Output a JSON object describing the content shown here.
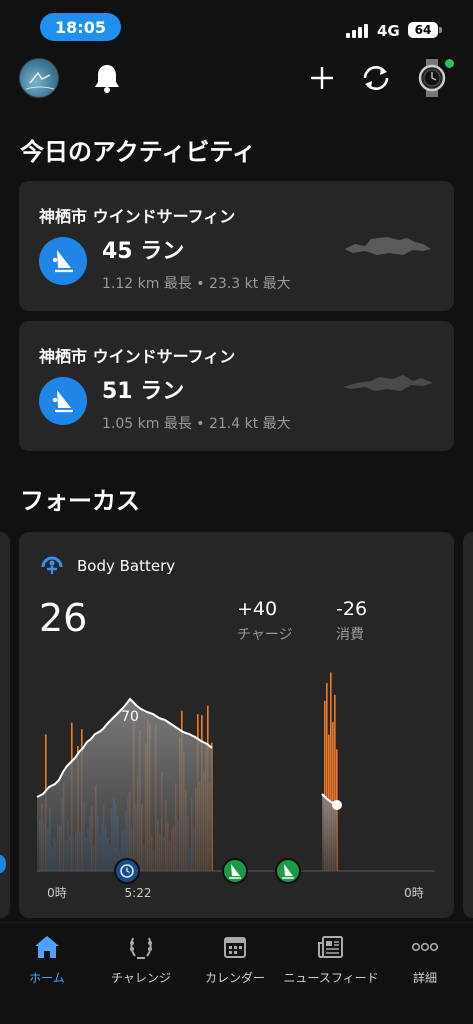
{
  "status_bar": {
    "time": "18:05",
    "network": "4G",
    "battery": "64"
  },
  "toolbar": {
    "icons": [
      "avatar",
      "bell-icon",
      "plus-icon",
      "sync-icon",
      "watch-icon"
    ]
  },
  "today": {
    "title": "今日のアクティビティ",
    "activities": [
      {
        "location": "神栖市 ウインドサーフィン",
        "count": "45 ラン",
        "stats": "1.12 km 最長 • 23.3 kt 最大",
        "icon": "windsurf-icon"
      },
      {
        "location": "神栖市 ウインドサーフィン",
        "count": "51 ラン",
        "stats": "1.05 km 最長 • 21.4 kt 最大",
        "icon": "windsurf-icon"
      }
    ]
  },
  "focus": {
    "title": "フォーカス",
    "body_battery": {
      "title": "Body Battery",
      "current": "26",
      "charge_value": "+40",
      "charge_label": "チャージ",
      "drain_value": "-26",
      "drain_label": "消費",
      "peak_label": "70",
      "x_labels": {
        "start": "0時",
        "mid": "5:22",
        "end": "0時"
      },
      "colors": {
        "sleep": "#2f80d8",
        "stress": "#f07a26",
        "level": "#9a9a9a",
        "activity_marker": "#1b9a48"
      }
    }
  },
  "bottom_nav": {
    "items": [
      {
        "label": "ホーム",
        "icon": "home-icon",
        "active": true
      },
      {
        "label": "チャレンジ",
        "icon": "laurel-icon",
        "active": false
      },
      {
        "label": "カレンダー",
        "icon": "calendar-icon",
        "active": false
      },
      {
        "label": "ニュースフィード",
        "icon": "newsfeed-icon",
        "active": false
      },
      {
        "label": "詳細",
        "icon": "more-icon",
        "active": false
      }
    ]
  },
  "colors": {
    "accent": "#1f86e8",
    "card": "#262626",
    "background": "#111111"
  }
}
